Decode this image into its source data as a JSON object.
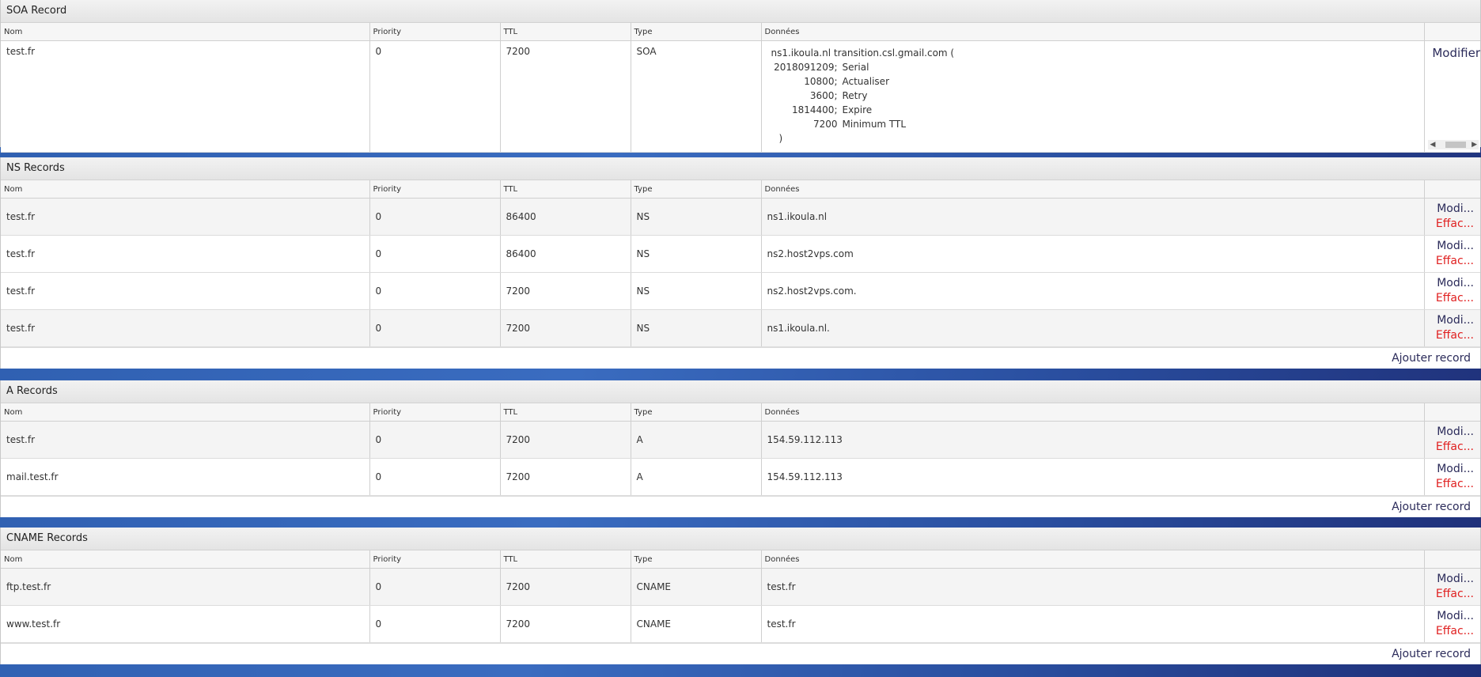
{
  "columns": {
    "nom": "Nom",
    "priority": "Priority",
    "ttl": "TTL",
    "type": "Type",
    "donnees": "Données"
  },
  "actions": {
    "modify": "Modi...",
    "delete": "Effac...",
    "modify_full": "Modifier",
    "add_record": "Ajouter record"
  },
  "soa": {
    "title": "SOA Record",
    "record": {
      "nom": "test.fr",
      "priority": "0",
      "ttl": "7200",
      "type": "SOA",
      "line1": "ns1.ikoula.nl transition.csl.gmail.com (",
      "serial": "2018091209;",
      "serial_label": "Serial",
      "refresh": "10800;",
      "refresh_label": "Actualiser",
      "retry": "3600;",
      "retry_label": "Retry",
      "expire": "1814400;",
      "expire_label": "Expire",
      "minimum": "7200",
      "minimum_label": "Minimum TTL",
      "close": ")"
    }
  },
  "ns": {
    "title": "NS Records",
    "records": [
      {
        "nom": "test.fr",
        "priority": "0",
        "ttl": "86400",
        "type": "NS",
        "donnees": "ns1.ikoula.nl"
      },
      {
        "nom": "test.fr",
        "priority": "0",
        "ttl": "86400",
        "type": "NS",
        "donnees": "ns2.host2vps.com"
      },
      {
        "nom": "test.fr",
        "priority": "0",
        "ttl": "7200",
        "type": "NS",
        "donnees": "ns2.host2vps.com."
      },
      {
        "nom": "test.fr",
        "priority": "0",
        "ttl": "7200",
        "type": "NS",
        "donnees": "ns1.ikoula.nl."
      }
    ]
  },
  "a": {
    "title": "A Records",
    "records": [
      {
        "nom": "test.fr",
        "priority": "0",
        "ttl": "7200",
        "type": "A",
        "donnees": "154.59.112.113"
      },
      {
        "nom": "mail.test.fr",
        "priority": "0",
        "ttl": "7200",
        "type": "A",
        "donnees": "154.59.112.113"
      }
    ]
  },
  "cname": {
    "title": "CNAME Records",
    "records": [
      {
        "nom": "ftp.test.fr",
        "priority": "0",
        "ttl": "7200",
        "type": "CNAME",
        "donnees": "test.fr"
      },
      {
        "nom": "www.test.fr",
        "priority": "0",
        "ttl": "7200",
        "type": "CNAME",
        "donnees": "test.fr"
      }
    ]
  }
}
